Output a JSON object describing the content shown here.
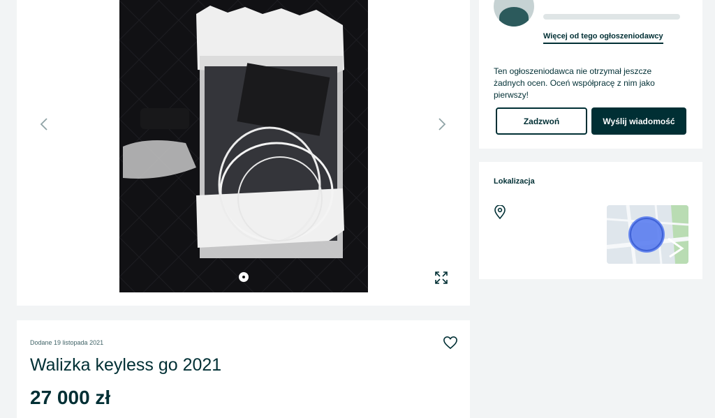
{
  "gallery": {
    "photo_alt": "Walizka keyless go 2021",
    "current_image": 1,
    "total_images": 1
  },
  "ad": {
    "added_date": "Dodane 19 listopada 2021",
    "title": "Walizka keyless go 2021",
    "price": "27 000 zł"
  },
  "seller": {
    "more_link": "Więcej od tego ogłoszeniodawcy",
    "rating_note": "Ten ogłoszeniodawca nie otrzymał jeszcze żadnych ocen. Oceń współpracę z nim jako pierwszy!",
    "call_label": "Zadzwoń",
    "message_label": "Wyślij wiadomość"
  },
  "location": {
    "title": "Lokalizacja"
  },
  "colors": {
    "brand": "#002f34",
    "page_bg": "#f2f4f5",
    "map_marker": "#4f73e8"
  },
  "icons": [
    "chevron-left-icon",
    "chevron-right-icon",
    "fullscreen-icon",
    "heart-icon",
    "location-pin-icon"
  ]
}
